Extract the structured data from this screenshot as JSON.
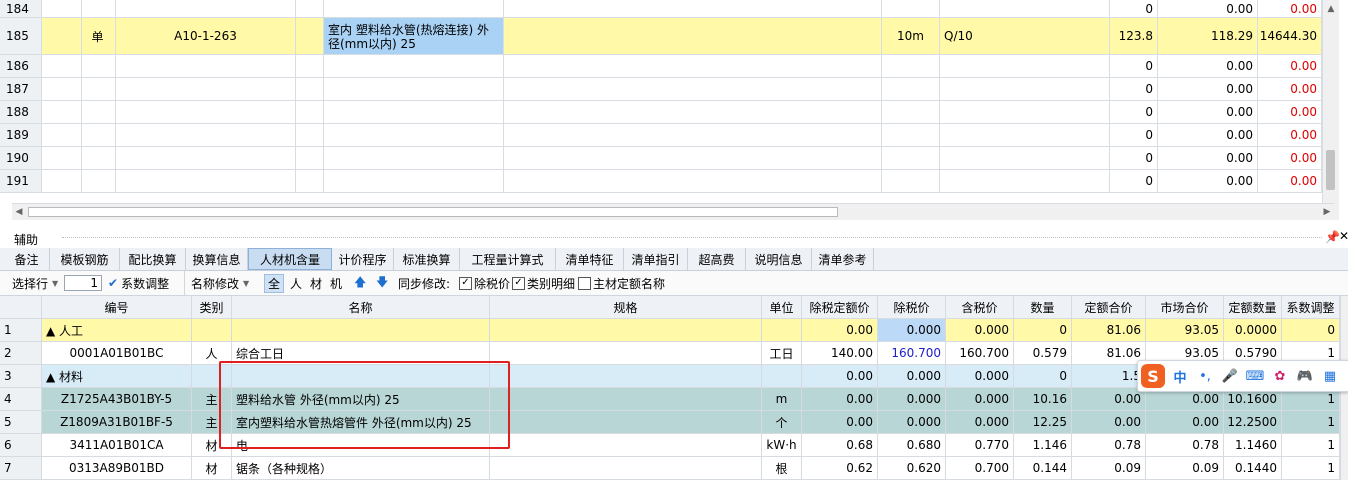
{
  "top_grid": {
    "rows": [
      {
        "num": "184",
        "type": "",
        "code": "",
        "name": "",
        "unit": "",
        "qty_expr": "",
        "qty": "0",
        "price": "0.00",
        "total": "0.00",
        "total_red": true
      },
      {
        "num": "185",
        "type": "单",
        "code": "A10-1-263",
        "name": "室内 塑料给水管(热熔连接) 外径(mm以内) 25",
        "unit": "10m",
        "qty_expr": "Q/10",
        "qty": "123.8",
        "price": "118.29",
        "total": "14644.30",
        "total_red": false
      },
      {
        "num": "186",
        "type": "",
        "code": "",
        "name": "",
        "unit": "",
        "qty_expr": "",
        "qty": "0",
        "price": "0.00",
        "total": "0.00",
        "total_red": true
      },
      {
        "num": "187",
        "type": "",
        "code": "",
        "name": "",
        "unit": "",
        "qty_expr": "",
        "qty": "0",
        "price": "0.00",
        "total": "0.00",
        "total_red": true
      },
      {
        "num": "188",
        "type": "",
        "code": "",
        "name": "",
        "unit": "",
        "qty_expr": "",
        "qty": "0",
        "price": "0.00",
        "total": "0.00",
        "total_red": true
      },
      {
        "num": "189",
        "type": "",
        "code": "",
        "name": "",
        "unit": "",
        "qty_expr": "",
        "qty": "0",
        "price": "0.00",
        "total": "0.00",
        "total_red": true
      },
      {
        "num": "190",
        "type": "",
        "code": "",
        "name": "",
        "unit": "",
        "qty_expr": "",
        "qty": "0",
        "price": "0.00",
        "total": "0.00",
        "total_red": true
      },
      {
        "num": "191",
        "type": "",
        "code": "",
        "name": "",
        "unit": "",
        "qty_expr": "",
        "qty": "0",
        "price": "0.00",
        "total": "0.00",
        "total_red": true
      }
    ]
  },
  "aux_panel": {
    "title": "辅助",
    "pin_icon": "pin-icon",
    "close_icon": "close-icon",
    "tabs": [
      "备注",
      "模板钢筋",
      "配比换算",
      "换算信息",
      "人材机含量",
      "计价程序",
      "标准换算",
      "工程量计算式",
      "清单特征",
      "清单指引",
      "超高费",
      "说明信息",
      "清单参考"
    ],
    "active_tab": "人材机含量"
  },
  "toolbar": {
    "select_row_label": "选择行",
    "coef_value": "1",
    "coef_adjust_label": "系数调整",
    "rename_label": "名称修改",
    "filters": [
      "全",
      "人",
      "材",
      "机"
    ],
    "sync_label": "同步修改:",
    "checkboxes": [
      {
        "label": "除税价",
        "checked": true
      },
      {
        "label": "类别明细",
        "checked": true
      },
      {
        "label": "主材定额名称",
        "checked": false
      }
    ]
  },
  "lower_grid": {
    "headers": [
      "编号",
      "类别",
      "名称",
      "规格",
      "单位",
      "除税定额价",
      "除税价",
      "含税价",
      "数量",
      "定额合价",
      "市场合价",
      "定额数量",
      "系数调整"
    ],
    "rows": [
      {
        "idx": "1",
        "code": "▲ 人工",
        "cat": "",
        "name": "",
        "spec": "",
        "unit": "",
        "base_price": "0.00",
        "ex_tax": "0.000",
        "in_tax": "0.000",
        "qty": "0",
        "base_total": "81.06",
        "market_total": "93.05",
        "base_qty": "0.0000",
        "coef": "0",
        "style": "yellow",
        "group": true
      },
      {
        "idx": "2",
        "code": "0001A01B01BC",
        "cat": "人",
        "name": "综合工日",
        "spec": "",
        "unit": "工日",
        "base_price": "140.00",
        "ex_tax": "160.700",
        "in_tax": "160.700",
        "qty": "0.579",
        "base_total": "81.06",
        "market_total": "93.05",
        "base_qty": "0.5790",
        "coef": "1",
        "style": "white",
        "group": false,
        "ex_tax_blue": true
      },
      {
        "idx": "3",
        "code": "▲ 材料",
        "cat": "",
        "name": "",
        "spec": "",
        "unit": "",
        "base_price": "0.00",
        "ex_tax": "0.000",
        "in_tax": "0.000",
        "qty": "0",
        "base_total": "1.5",
        "market_total": "",
        "base_qty": "",
        "coef": "",
        "style": "blue",
        "group": true
      },
      {
        "idx": "4",
        "code": "Z1725A43B01BY-5",
        "cat": "主",
        "name": "塑料给水管 外径(mm以内) 25",
        "spec": "",
        "unit": "m",
        "base_price": "0.00",
        "ex_tax": "0.000",
        "in_tax": "0.000",
        "qty": "10.16",
        "base_total": "0.00",
        "market_total": "0.00",
        "base_qty": "10.1600",
        "coef": "1",
        "style": "sel",
        "group": false
      },
      {
        "idx": "5",
        "code": "Z1809A31B01BF-5",
        "cat": "主",
        "name": "室内塑料给水管热熔管件 外径(mm以内) 25",
        "spec": "",
        "unit": "个",
        "base_price": "0.00",
        "ex_tax": "0.000",
        "in_tax": "0.000",
        "qty": "12.25",
        "base_total": "0.00",
        "market_total": "0.00",
        "base_qty": "12.2500",
        "coef": "1",
        "style": "sel",
        "group": false
      },
      {
        "idx": "6",
        "code": "3411A01B01CA",
        "cat": "材",
        "name": "电",
        "spec": "",
        "unit": "kW·h",
        "base_price": "0.68",
        "ex_tax": "0.680",
        "in_tax": "0.770",
        "qty": "1.146",
        "base_total": "0.78",
        "market_total": "0.78",
        "base_qty": "1.1460",
        "coef": "1",
        "style": "white",
        "group": false
      },
      {
        "idx": "7",
        "code": "0313A89B01BD",
        "cat": "材",
        "name": "锯条（各种规格）",
        "spec": "",
        "unit": "根",
        "base_price": "0.62",
        "ex_tax": "0.620",
        "in_tax": "0.700",
        "qty": "0.144",
        "base_total": "0.09",
        "market_total": "0.09",
        "base_qty": "0.1440",
        "coef": "1",
        "style": "white",
        "group": false
      }
    ]
  },
  "ime": {
    "logo": "S",
    "mode": "中",
    "punct": "•,",
    "icons": [
      "mic-icon",
      "keyboard-icon",
      "skin-icon",
      "game-icon",
      "grid-icon"
    ]
  }
}
